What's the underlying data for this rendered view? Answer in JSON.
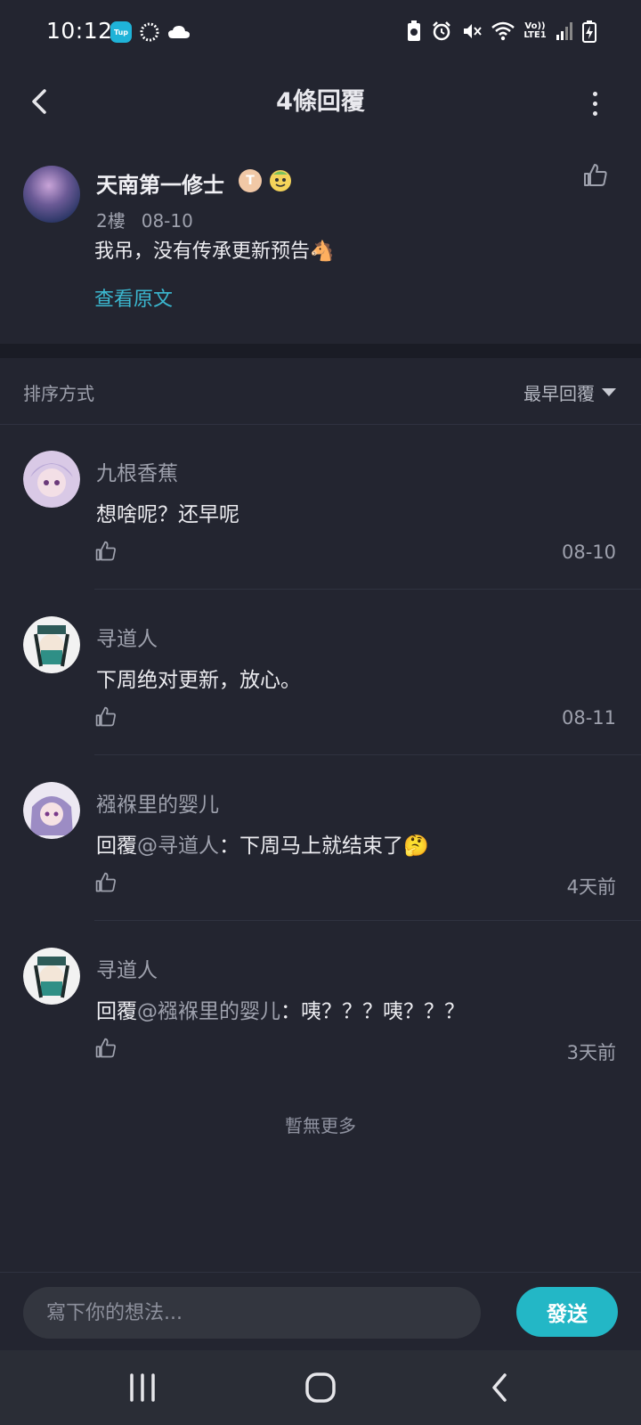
{
  "status_bar": {
    "time": "10:12",
    "left_icons": [
      "tup-app-icon",
      "sync-ring-icon",
      "cloud-icon"
    ],
    "tup_label": "Tup",
    "right_icons": [
      "battery-saver-icon",
      "alarm-icon",
      "mute-icon",
      "wifi-icon",
      "signal-icon",
      "battery-charging-icon"
    ],
    "volte_label": "Vo)) LTE1"
  },
  "header": {
    "title": "4條回覆"
  },
  "original_post": {
    "author": "天南第一修士",
    "badge_letter": "T",
    "floor": "2樓",
    "date": "08-10",
    "text": "我吊，没有传承更新预告🐴",
    "view_original": "查看原文"
  },
  "sort": {
    "label": "排序方式",
    "selected": "最早回覆"
  },
  "replies": [
    {
      "author": "九根香蕉",
      "text": "想啥呢？还早呢",
      "time": "08-10"
    },
    {
      "author": "寻道人",
      "text": "下周绝对更新，放心。",
      "time": "08-11"
    },
    {
      "author": "襁褓里的婴儿",
      "reply_prefix": "回覆",
      "mention": "@寻道人",
      "text": "：下周马上就结束了🤔",
      "time": "4天前"
    },
    {
      "author": "寻道人",
      "reply_prefix": "回覆",
      "mention": "@襁褓里的婴儿",
      "text": "：咦？？？咦？？？",
      "time": "3天前"
    }
  ],
  "footer_note": "暫無更多",
  "composer": {
    "placeholder": "寫下你的想法...",
    "send_label": "發送"
  },
  "colors": {
    "background": "#232530",
    "accent": "#23b7c6",
    "link": "#3bb8d0",
    "muted_text": "#9ea1ad"
  }
}
